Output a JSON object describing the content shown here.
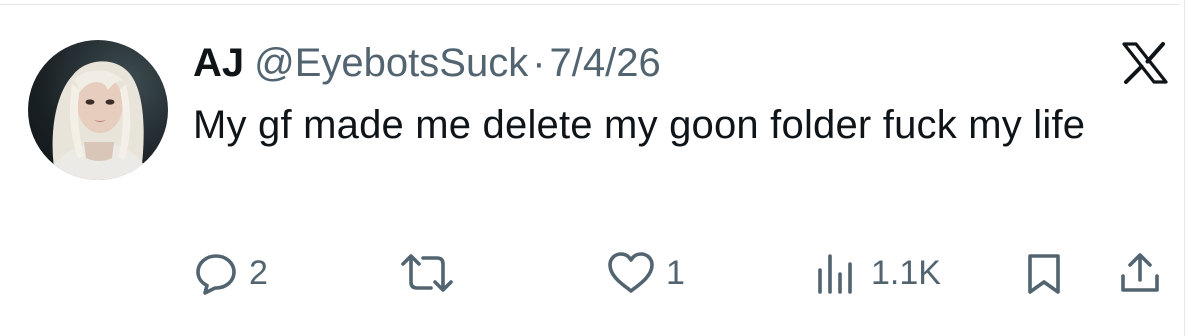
{
  "tweet": {
    "author_name": "AJ",
    "handle": "@EyebotsSuck",
    "separator": "·",
    "date": "7/4/26",
    "text": "My gf made me delete my goon folder fuck my life"
  },
  "actions": {
    "replies": {
      "icon": "reply-icon",
      "count": "2"
    },
    "reposts": {
      "icon": "repost-icon",
      "count": ""
    },
    "likes": {
      "icon": "heart-icon",
      "count": "1"
    },
    "views": {
      "icon": "views-icon",
      "count": "1.1K"
    },
    "bookmark": {
      "icon": "bookmark-icon"
    },
    "share": {
      "icon": "share-icon"
    }
  },
  "colors": {
    "text": "#0f1419",
    "secondary": "#536471",
    "background": "#ffffff"
  }
}
